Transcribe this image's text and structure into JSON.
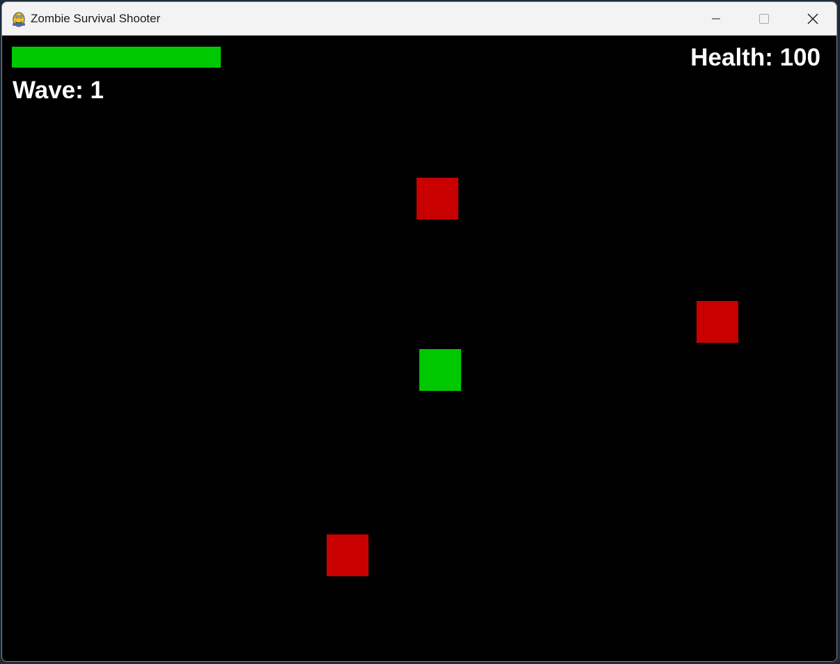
{
  "window": {
    "title": "Zombie Survival Shooter",
    "app_icon": "pygame-snake-icon",
    "controls": [
      "minimize-icon",
      "maximize-icon",
      "close-icon"
    ]
  },
  "hud": {
    "health_bar": {
      "fraction": 1.0,
      "color": "#00c800"
    },
    "wave_text": "Wave: 1",
    "health_text": "Health: 100"
  },
  "entities": {
    "player_color": "#00c800",
    "zombie_color": "#c80000",
    "zombie_count": 3
  }
}
